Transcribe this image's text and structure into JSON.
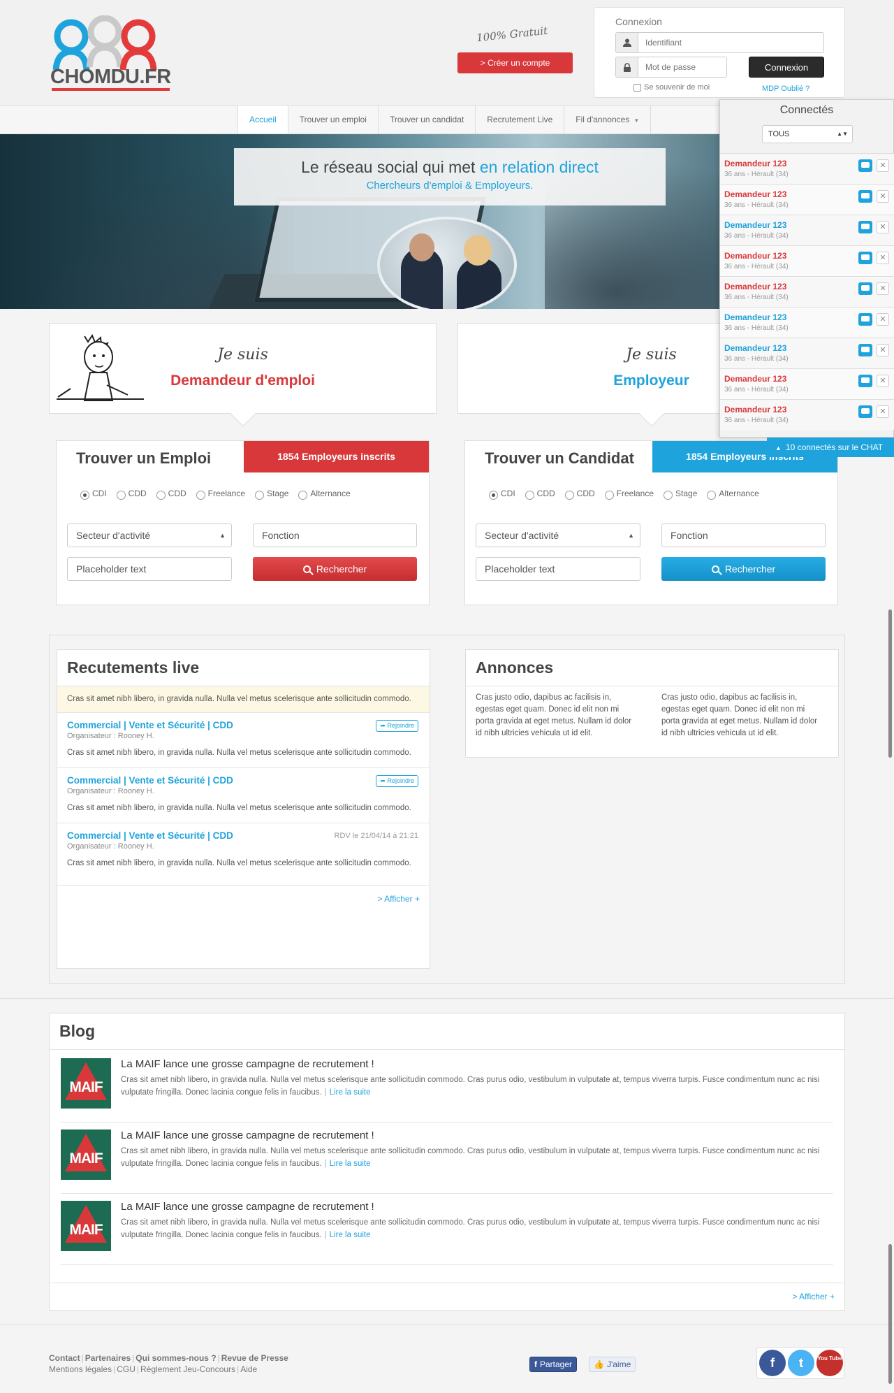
{
  "header": {
    "brand": "CHOMDU.FR",
    "free_text": "100% Gratuit",
    "signup_label": "> Créer un compte",
    "login": {
      "title": "Connexion",
      "username_placeholder": "Identifiant",
      "password_placeholder": "Mot de passe",
      "submit_label": "Connexion",
      "remember_label": "Se souvenir de moi",
      "forgot_label": "MDP Oublié ?"
    }
  },
  "nav": {
    "items": [
      "Accueil",
      "Trouver un emploi",
      "Trouver un candidat",
      "Recrutement Live",
      "Fil d'annonces"
    ]
  },
  "hero": {
    "line1_a": "Le réseau social qui met ",
    "line1_b": "en relation direct",
    "line2": "Chercheurs d'emploi & Employeurs."
  },
  "seeker": {
    "je_suis": "Je suis",
    "role": "Demandeur d'emploi",
    "title": "Trouver un Emploi",
    "badge": "1854 Employeurs inscrits",
    "contracts": [
      "CDI",
      "CDD",
      "CDD",
      "Freelance",
      "Stage",
      "Alternance"
    ],
    "sector": "Secteur d'activité",
    "function_placeholder": "Fonction",
    "text_placeholder": "Placeholder text",
    "search_label": "Rechercher"
  },
  "employer": {
    "je_suis": "Je suis",
    "role": "Employeur",
    "title": "Trouver un Candidat",
    "badge": "1854 Employeurs inscrits",
    "contracts": [
      "CDI",
      "CDD",
      "CDD",
      "Freelance",
      "Stage",
      "Alternance"
    ],
    "sector": "Secteur d'activité",
    "function_placeholder": "Fonction",
    "text_placeholder": "Placeholder text",
    "search_label": "Rechercher"
  },
  "live": {
    "title": "Recutements live",
    "notice": "Cras sit amet nibh libero, in gravida nulla. Nulla vel metus scelerisque ante sollicitudin commodo.",
    "events": [
      {
        "title": "Commercial | Vente et Sécurité | CDD",
        "organizer": "Organisateur : Rooney H.",
        "desc": "Cras sit amet nibh libero, in gravida nulla. Nulla vel metus scelerisque ante sollicitudin commodo.",
        "action": "Rejoindre"
      },
      {
        "title": "Commercial | Vente et Sécurité | CDD",
        "organizer": "Organisateur : Rooney H.",
        "desc": "Cras sit amet nibh libero, in gravida nulla. Nulla vel metus scelerisque ante sollicitudin commodo.",
        "action": "Rejoindre"
      },
      {
        "title": "Commercial | Vente et Sécurité | CDD",
        "organizer": "Organisateur : Rooney H.",
        "desc": "Cras sit amet nibh libero, in gravida nulla. Nulla vel metus scelerisque ante sollicitudin commodo.",
        "rdv": "RDV le 21/04/14 à 21:21"
      }
    ],
    "more": "> Afficher +"
  },
  "annonces": {
    "title": "Annonces",
    "cols": [
      "Cras justo odio, dapibus ac facilisis in, egestas eget quam. Donec id elit non mi porta gravida at eget metus. Nullam id dolor id nibh ultricies vehicula ut id elit.",
      "Cras justo odio, dapibus ac facilisis in, egestas eget quam. Donec id elit non mi porta gravida at eget metus. Nullam id dolor id nibh ultricies vehicula ut id elit."
    ]
  },
  "blog": {
    "title": "Blog",
    "posts": [
      {
        "thumb": "MAIF",
        "title": "La MAIF lance une grosse campagne de recrutement !",
        "body": "Cras sit amet nibh libero, in gravida nulla. Nulla vel metus scelerisque ante sollicitudin commodo. Cras purus odio, vestibulum in vulputate at, tempus viverra turpis. Fusce condimentum nunc ac nisi vulputate fringilla. Donec lacinia congue felis in faucibus.",
        "sep": "|",
        "link": "Lire la suite"
      },
      {
        "thumb": "MAIF",
        "title": "La MAIF lance une grosse campagne de recrutement !",
        "body": "Cras sit amet nibh libero, in gravida nulla. Nulla vel metus scelerisque ante sollicitudin commodo. Cras purus odio, vestibulum in vulputate at, tempus viverra turpis. Fusce condimentum nunc ac nisi vulputate fringilla. Donec lacinia congue felis in faucibus.",
        "sep": "|",
        "link": "Lire la suite"
      },
      {
        "thumb": "MAIF",
        "title": "La MAIF lance une grosse campagne de recrutement !",
        "body": "Cras sit amet nibh libero, in gravida nulla. Nulla vel metus scelerisque ante sollicitudin commodo. Cras purus odio, vestibulum in vulputate at, tempus viverra turpis. Fusce condimentum nunc ac nisi vulputate fringilla. Donec lacinia congue felis in faucibus.",
        "sep": "|",
        "link": "Lire la suite"
      }
    ],
    "more": "> Afficher +"
  },
  "footer": {
    "row1": [
      "Contact",
      "Partenaires",
      "Qui sommes-nous ?",
      "Revue de Presse"
    ],
    "row2": [
      "Mentions légales",
      "CGU",
      "Règlement Jeu-Concours",
      "Aide"
    ],
    "share_label": "Partager",
    "like_label": "J'aime",
    "social": [
      "f",
      "t",
      "You Tube"
    ]
  },
  "chat": {
    "title": "Connectés",
    "filter": "TOUS",
    "users": [
      {
        "name": "Demandeur 123",
        "meta": "36 ans - Hérault (34)",
        "color": "#d9383b"
      },
      {
        "name": "Demandeur 123",
        "meta": "36 ans - Hérault (34)",
        "color": "#d9383b"
      },
      {
        "name": "Demandeur 123",
        "meta": "36 ans - Hérault (34)",
        "color": "#1fa3dc"
      },
      {
        "name": "Demandeur 123",
        "meta": "36 ans - Hérault (34)",
        "color": "#d9383b"
      },
      {
        "name": "Demandeur 123",
        "meta": "36 ans - Hérault (34)",
        "color": "#d9383b"
      },
      {
        "name": "Demandeur 123",
        "meta": "36 ans - Hérault (34)",
        "color": "#1fa3dc"
      },
      {
        "name": "Demandeur 123",
        "meta": "36 ans - Hérault (34)",
        "color": "#1fa3dc"
      },
      {
        "name": "Demandeur 123",
        "meta": "36 ans - Hérault (34)",
        "color": "#d9383b"
      },
      {
        "name": "Demandeur 123",
        "meta": "36 ans - Hérault (34)",
        "color": "#d9383b"
      }
    ],
    "bar_label": "10 connectés sur le CHAT"
  },
  "colors": {
    "accent_blue": "#1fa3dc",
    "accent_red": "#d9383b"
  }
}
